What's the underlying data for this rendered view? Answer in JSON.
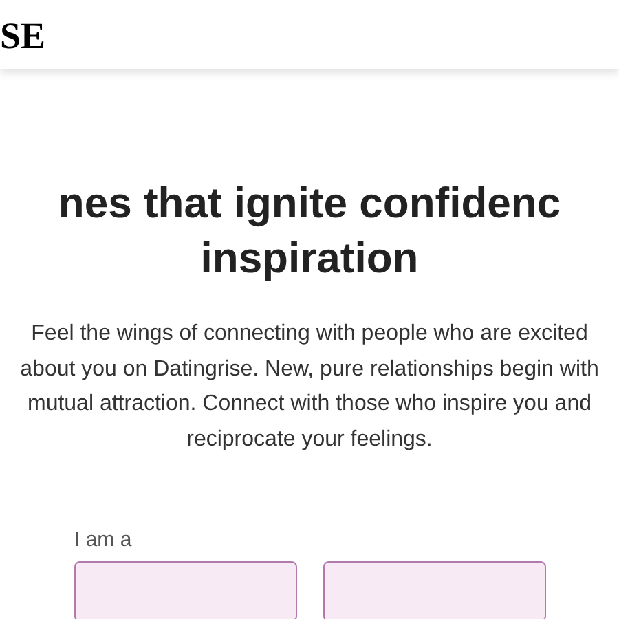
{
  "header": {
    "logo": "SE"
  },
  "hero": {
    "title_lines": [
      "nes that ignite confidenc",
      "inspiration"
    ],
    "description": "Feel the wings of connecting with people who are excited about you on Datingrise. New, pure relationships begin with mutual attraction. Connect with those who inspire you and reciprocate your feelings."
  },
  "form": {
    "label": "I am a",
    "fields": [
      {
        "kind": "select"
      },
      {
        "kind": "select"
      }
    ]
  }
}
